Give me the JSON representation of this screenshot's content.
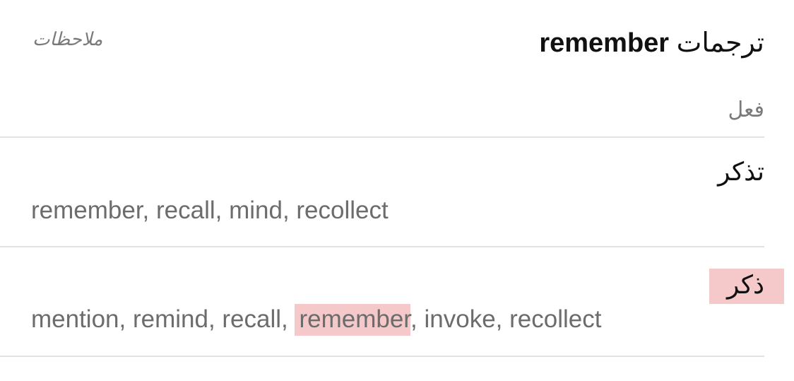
{
  "header": {
    "prefix": "ترجمات",
    "word": "remember",
    "notes_label": "ملاحظات"
  },
  "part_of_speech": "فعل",
  "translations": [
    {
      "term": "تذكر",
      "synonyms_text": "remember, recall, mind, recollect"
    },
    {
      "term": "ذكر",
      "synonyms_before": "mention, remind, recall, ",
      "synonyms_highlight": "remember",
      "synonyms_after": ", invoke, recollect",
      "highlighted": true,
      "highlight_color": "#f5c9c9"
    }
  ]
}
